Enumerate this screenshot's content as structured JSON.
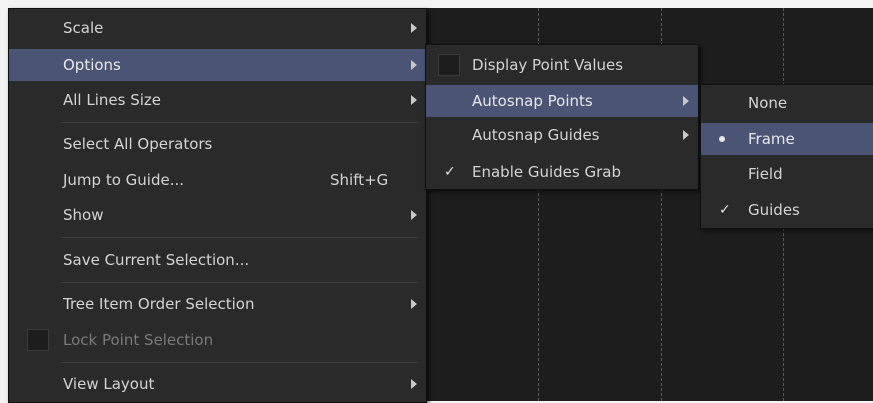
{
  "main_menu": {
    "items": [
      {
        "label": "Scale"
      },
      {
        "label": "Options"
      },
      {
        "label": "All Lines Size"
      },
      {
        "label": "Select All Operators"
      },
      {
        "label": "Jump to Guide...",
        "shortcut": "Shift+G"
      },
      {
        "label": "Show"
      },
      {
        "label": "Save Current Selection..."
      },
      {
        "label": "Tree Item Order Selection"
      },
      {
        "label": "Lock Point Selection"
      },
      {
        "label": "View Layout"
      }
    ]
  },
  "options_menu": {
    "items": [
      {
        "label": "Display Point Values"
      },
      {
        "label": "Autosnap Points"
      },
      {
        "label": "Autosnap Guides"
      },
      {
        "label": "Enable Guides Grab",
        "check": "✓"
      }
    ]
  },
  "autosnap_points_menu": {
    "items": [
      {
        "label": "None"
      },
      {
        "label": "Frame"
      },
      {
        "label": "Field"
      },
      {
        "label": "Guides",
        "check": "✓"
      }
    ]
  }
}
